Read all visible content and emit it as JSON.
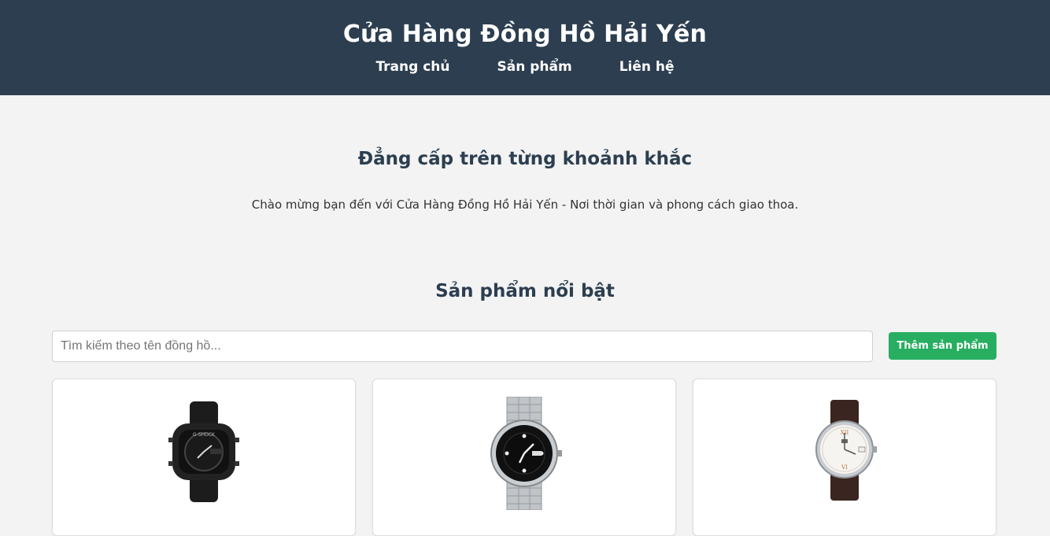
{
  "header": {
    "title": "Cửa Hàng Đồng Hồ Hải Yến",
    "nav": [
      "Trang chủ",
      "Sản phẩm",
      "Liên hệ"
    ]
  },
  "hero": {
    "title": "Đẳng cấp trên từng khoảnh khắc",
    "text": "Chào mừng bạn đến với Cửa Hàng Đồng Hồ Hải Yến - Nơi thời gian và phong cách giao thoa."
  },
  "featured": {
    "title": "Sản phẩm nổi bật",
    "search_placeholder": "Tìm kiếm theo tên đồng hồ...",
    "add_button_label": "Thêm sản phẩm"
  },
  "products": [
    {
      "image": "black-digital-sport-watch-icon"
    },
    {
      "image": "steel-diver-watch-icon"
    },
    {
      "image": "leather-dress-watch-icon"
    }
  ],
  "colors": {
    "header_bg": "#2c3e50",
    "page_bg": "#f3f3f3",
    "accent_green": "#27ae60"
  }
}
